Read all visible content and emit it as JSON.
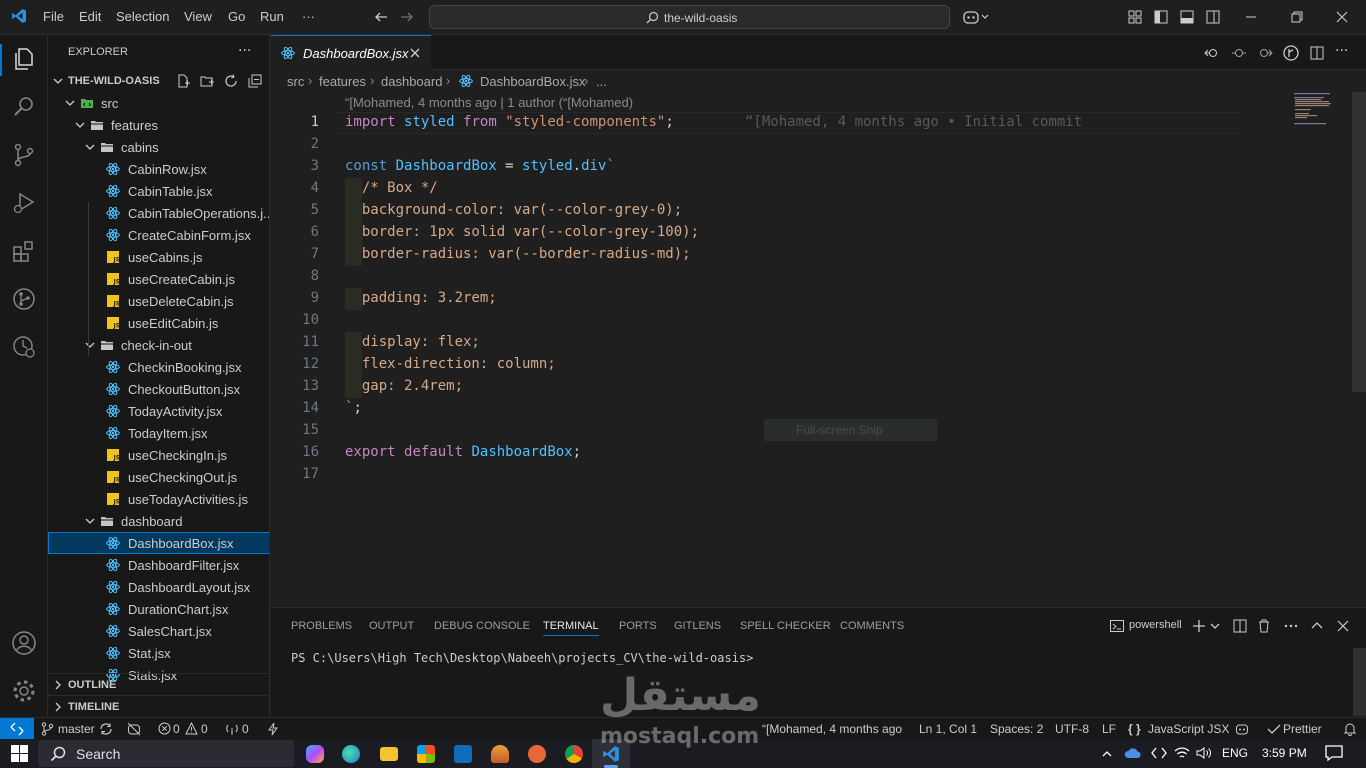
{
  "titlebar": {
    "menu": [
      "File",
      "Edit",
      "Selection",
      "View",
      "Go",
      "Run",
      "···"
    ],
    "search": "the-wild-oasis"
  },
  "sidebar": {
    "title": "EXPLORER",
    "more": "···",
    "project": "THE-WILD-OASIS",
    "tree": [
      {
        "label": "src",
        "type": "folder-src",
        "depth": 1
      },
      {
        "label": "features",
        "type": "folder",
        "depth": 2
      },
      {
        "label": "cabins",
        "type": "folder",
        "depth": 3
      },
      {
        "label": "CabinRow.jsx",
        "type": "jsx",
        "depth": 4
      },
      {
        "label": "CabinTable.jsx",
        "type": "jsx",
        "depth": 4
      },
      {
        "label": "CabinTableOperations.j...",
        "type": "jsx",
        "depth": 4
      },
      {
        "label": "CreateCabinForm.jsx",
        "type": "jsx",
        "depth": 4
      },
      {
        "label": "useCabins.js",
        "type": "js",
        "depth": 4
      },
      {
        "label": "useCreateCabin.js",
        "type": "js",
        "depth": 4
      },
      {
        "label": "useDeleteCabin.js",
        "type": "js",
        "depth": 4
      },
      {
        "label": "useEditCabin.js",
        "type": "js",
        "depth": 4
      },
      {
        "label": "check-in-out",
        "type": "folder",
        "depth": 3
      },
      {
        "label": "CheckinBooking.jsx",
        "type": "jsx",
        "depth": 4
      },
      {
        "label": "CheckoutButton.jsx",
        "type": "jsx",
        "depth": 4
      },
      {
        "label": "TodayActivity.jsx",
        "type": "jsx",
        "depth": 4
      },
      {
        "label": "TodayItem.jsx",
        "type": "jsx",
        "depth": 4
      },
      {
        "label": "useCheckingIn.js",
        "type": "js",
        "depth": 4
      },
      {
        "label": "useCheckingOut.js",
        "type": "js",
        "depth": 4
      },
      {
        "label": "useTodayActivities.js",
        "type": "js",
        "depth": 4
      },
      {
        "label": "dashboard",
        "type": "folder",
        "depth": 3
      },
      {
        "label": "DashboardBox.jsx",
        "type": "jsx",
        "depth": 4,
        "selected": true
      },
      {
        "label": "DashboardFilter.jsx",
        "type": "jsx",
        "depth": 4
      },
      {
        "label": "DashboardLayout.jsx",
        "type": "jsx",
        "depth": 4
      },
      {
        "label": "DurationChart.jsx",
        "type": "jsx",
        "depth": 4
      },
      {
        "label": "SalesChart.jsx",
        "type": "jsx",
        "depth": 4
      },
      {
        "label": "Stat.jsx",
        "type": "jsx",
        "depth": 4
      },
      {
        "label": "Stats.jsx",
        "type": "jsx",
        "depth": 4
      }
    ],
    "outline": "OUTLINE",
    "timeline": "TIMELINE"
  },
  "editor": {
    "tab": "DashboardBox.jsx",
    "breadcrumb": [
      "src",
      "features",
      "dashboard",
      "DashboardBox.jsx",
      "..."
    ],
    "blame_top": "“[Mohamed, 4 months ago | 1 author (“[Mohamed)",
    "blame_inline": "“[Mohamed, 4 months ago • Initial commit",
    "snip": "Full-screen Snip",
    "lines": [
      [
        [
          "import",
          "cl"
        ],
        [
          " ",
          "pn"
        ],
        [
          "styled",
          "fn"
        ],
        [
          " ",
          "pn"
        ],
        [
          "from",
          "cl"
        ],
        [
          " ",
          "pn"
        ],
        [
          "\"styled-components\"",
          "st"
        ],
        [
          ";",
          "pn"
        ]
      ],
      [],
      [
        [
          "const",
          "kw"
        ],
        [
          " ",
          "pn"
        ],
        [
          "DashboardBox",
          "fn"
        ],
        [
          " = ",
          "pn"
        ],
        [
          "styled",
          "fn"
        ],
        [
          ".",
          "pn"
        ],
        [
          "div",
          "fn"
        ],
        [
          "`",
          "st"
        ]
      ],
      [
        [
          "  /* Box */",
          "cm"
        ]
      ],
      [
        [
          "  background-color: var(--color-grey-0);",
          "cm"
        ]
      ],
      [
        [
          "  border: 1px solid var(--color-grey-100);",
          "cm"
        ]
      ],
      [
        [
          "  border-radius: var(--border-radius-md);",
          "cm"
        ]
      ],
      [],
      [
        [
          "  padding: 3.2rem;",
          "cm"
        ]
      ],
      [],
      [
        [
          "  display: flex;",
          "cm"
        ]
      ],
      [
        [
          "  flex-direction: column;",
          "cm"
        ]
      ],
      [
        [
          "  gap: 2.4rem;",
          "cm"
        ]
      ],
      [
        [
          "`",
          "st"
        ],
        [
          ";",
          "pn"
        ]
      ],
      [],
      [
        [
          "export",
          "cl"
        ],
        [
          " ",
          "pn"
        ],
        [
          "default",
          "cl"
        ],
        [
          " ",
          "pn"
        ],
        [
          "DashboardBox",
          "fn"
        ],
        [
          ";",
          "pn"
        ]
      ],
      []
    ]
  },
  "panel": {
    "tabs": [
      "PROBLEMS",
      "OUTPUT",
      "DEBUG CONSOLE",
      "TERMINAL",
      "PORTS",
      "GITLENS",
      "SPELL CHECKER",
      "COMMENTS"
    ],
    "active_tab": "TERMINAL",
    "shell": "powershell",
    "prompt": "PS C:\\Users\\High Tech\\Desktop\\Nabeeh\\projects_CV\\the-wild-oasis>"
  },
  "statusbar": {
    "branch": "master",
    "errors": "0",
    "warnings": "0",
    "ports": "0",
    "blame": "“[Mohamed, 4 months ago",
    "position": "Ln 1, Col 1",
    "spaces": "Spaces: 2",
    "encoding": "UTF-8",
    "eol": "LF",
    "language": "JavaScript JSX",
    "formatter": "Prettier"
  },
  "taskbar": {
    "search": "Search",
    "lang": "ENG",
    "time": "3:59 PM"
  },
  "watermark": {
    "arabic": "مستقل",
    "latin": "mostaql.com"
  },
  "colors": {
    "accent": "#0078d4",
    "keyword": "#c586c0",
    "identifier": "#4fc1ff",
    "string": "#ce9178"
  }
}
